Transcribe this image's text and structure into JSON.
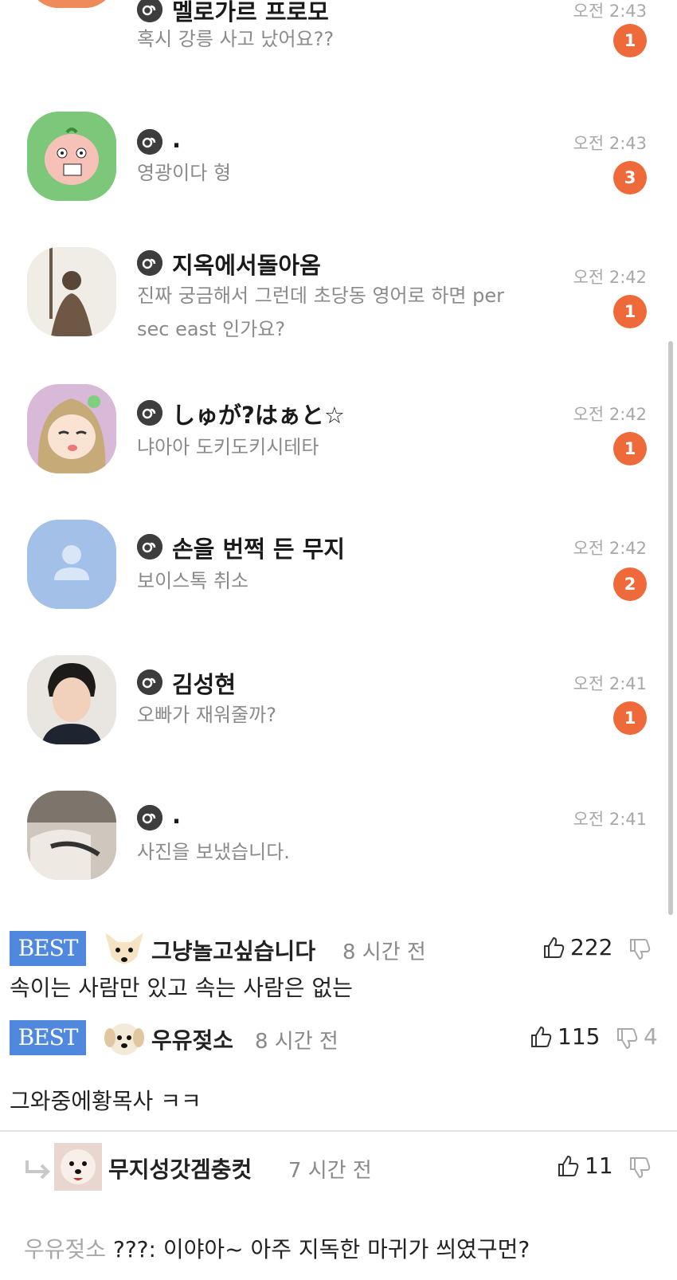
{
  "chat_rows": [
    {
      "name": "멜로가르 프로모",
      "message": "혹시 강릉 사고 났어요??",
      "time": "오전 2:43",
      "unread": "1",
      "avatar": "dog-avatar"
    },
    {
      "name": ".",
      "message": "영광이다 형",
      "time": "오전 2:43",
      "unread": "3",
      "avatar": "peach-avatar"
    },
    {
      "name": "지옥에서돌아옴",
      "message": "진짜 궁금해서 그런데 초당동 영어로 하면 per sec east 인가요?",
      "time": "오전 2:42",
      "unread": "1",
      "avatar": "photo-avatar"
    },
    {
      "name": "しゅが?はぁと☆",
      "message": "냐아아 도키도키시테타",
      "time": "오전 2:42",
      "unread": "1",
      "avatar": "anime-avatar"
    },
    {
      "name": "손을 번쩍 든 무지",
      "message": "보이스톡 취소",
      "time": "오전 2:42",
      "unread": "2",
      "avatar": "default-avatar"
    },
    {
      "name": "김성현",
      "message": "오빠가 재워줄까?",
      "time": "오전 2:41",
      "unread": "1",
      "avatar": "person-avatar"
    },
    {
      "name": ".",
      "message": "사진을 보냈습니다.",
      "time": "오전 2:41",
      "unread": "",
      "avatar": "photo-avatar-2"
    }
  ],
  "comments": [
    {
      "badge": "BEST",
      "nickname": "그냥놀고싶습니다",
      "time": "8 시간 전",
      "likes": "222",
      "dislikes": "",
      "body": "속이는 사람만 있고 속는 사람은 없는"
    },
    {
      "badge": "BEST",
      "nickname": "우유젖소",
      "time": "8 시간 전",
      "likes": "115",
      "dislikes": "4",
      "body": "그와중에황목사 ㅋㅋ"
    }
  ],
  "reply": {
    "nickname": "무지성갓겜충컷",
    "time": "7 시간 전",
    "likes": "11",
    "dislikes": "",
    "mention": "우유젖소",
    "body": "???: 이야아~ 아주 지독한 마귀가 씌였구먼?"
  },
  "colors": {
    "badge": "#4f88dd",
    "unread": "#ef6a3a",
    "open_chat_icon": "#3d3d3d"
  }
}
